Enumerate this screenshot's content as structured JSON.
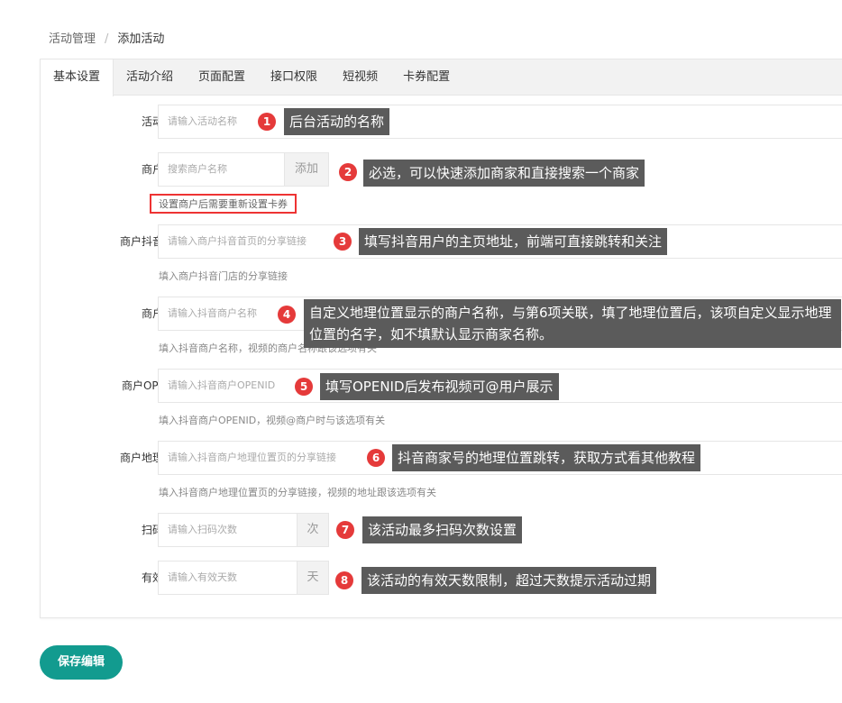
{
  "breadcrumb": {
    "parent": "活动管理",
    "separator": "/",
    "current": "添加活动"
  },
  "tabs": [
    {
      "label": "基本设置"
    },
    {
      "label": "活动介绍"
    },
    {
      "label": "页面配置"
    },
    {
      "label": "接口权限"
    },
    {
      "label": "短视频"
    },
    {
      "label": "卡券配置"
    }
  ],
  "fields": {
    "activity_name": {
      "label": "活动名称",
      "placeholder": "请输入活动名称"
    },
    "merchant": {
      "label": "商户名称",
      "placeholder": "搜索商户名称",
      "addon": "添加",
      "hint": "设置商户后需要重新设置卡券"
    },
    "douyin_home": {
      "label": "商户抖音主页",
      "placeholder": "请输入商户抖音首页的分享链接",
      "hint": "填入商户抖音门店的分享链接"
    },
    "douyin_name": {
      "label": "商户名称",
      "placeholder": "请输入抖音商户名称",
      "hint": "填入抖音商户名称，视频的商户名称跟该选项有关"
    },
    "openid": {
      "label": "商户OPENID",
      "placeholder": "请输入抖音商户OPENID",
      "hint": "填入抖音商户OPENID，视频@商户时与该选项有关"
    },
    "location": {
      "label": "商户地理位置",
      "placeholder": "请输入抖音商户地理位置页的分享链接",
      "hint": "填入抖音商户地理位置页的分享链接，视频的地址跟该选项有关"
    },
    "scan_count": {
      "label": "扫码次数",
      "placeholder": "请输入扫码次数",
      "addon": "次"
    },
    "valid_days": {
      "label": "有效天数",
      "placeholder": "请输入有效天数",
      "addon": "天"
    }
  },
  "annotations": [
    {
      "num": "1",
      "text": "后台活动的名称"
    },
    {
      "num": "2",
      "text": "必选，可以快速添加商家和直接搜索一个商家"
    },
    {
      "num": "3",
      "text": "填写抖音用户的主页地址，前端可直接跳转和关注"
    },
    {
      "num": "4",
      "text": "自定义地理位置显示的商户名称，与第6项关联，填了地理位置后，该项自定义显示地理位置的名字，如不填默认显示商家名称。"
    },
    {
      "num": "5",
      "text": "填写OPENID后发布视频可@用户展示"
    },
    {
      "num": "6",
      "text": "抖音商家号的地理位置跳转，获取方式看其他教程"
    },
    {
      "num": "7",
      "text": "该活动最多扫码次数设置"
    },
    {
      "num": "8",
      "text": "该活动的有效天数限制，超过天数提示活动过期"
    }
  ],
  "save_button": "保存编辑",
  "colors": {
    "primary": "#129b8f",
    "badge": "#e53a3a",
    "tooltip": "#5b5b5b"
  }
}
